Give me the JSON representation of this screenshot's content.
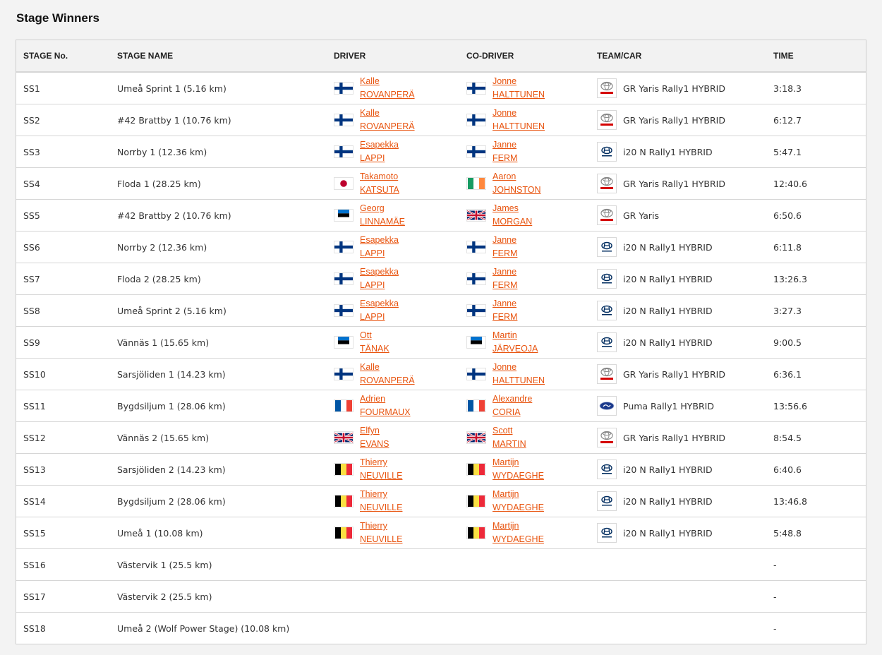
{
  "page_title": "Stage Winners",
  "headers": [
    "STAGE No.",
    "STAGE NAME",
    "DRIVER",
    "CO-DRIVER",
    "TEAM/CAR",
    "TIME"
  ],
  "rows": [
    {
      "stage": "SS1",
      "name": "Umeå Sprint 1 (5.16 km)",
      "driver_first": "Kalle",
      "driver_last": "ROVANPERÄ",
      "driver_flag": "finland-flag-icon",
      "codriver_first": "Jonne",
      "codriver_last": "HALTTUNEN",
      "codriver_flag": "finland-flag-icon",
      "logo": "toyota-logo-icon",
      "car": "GR Yaris Rally1 HYBRID",
      "time": "3:18.3"
    },
    {
      "stage": "SS2",
      "name": "#42 Brattby 1 (10.76 km)",
      "driver_first": "Kalle",
      "driver_last": "ROVANPERÄ",
      "driver_flag": "finland-flag-icon",
      "codriver_first": "Jonne",
      "codriver_last": "HALTTUNEN",
      "codriver_flag": "finland-flag-icon",
      "logo": "toyota-logo-icon",
      "car": "GR Yaris Rally1 HYBRID",
      "time": "6:12.7"
    },
    {
      "stage": "SS3",
      "name": "Norrby 1 (12.36 km)",
      "driver_first": "Esapekka",
      "driver_last": "LAPPI",
      "driver_flag": "finland-flag-icon",
      "codriver_first": "Janne",
      "codriver_last": "FERM",
      "codriver_flag": "finland-flag-icon",
      "logo": "hyundai-logo-icon",
      "car": "i20 N Rally1 HYBRID",
      "time": "5:47.1"
    },
    {
      "stage": "SS4",
      "name": "Floda 1 (28.25 km)",
      "driver_first": "Takamoto",
      "driver_last": "KATSUTA",
      "driver_flag": "japan-flag-icon",
      "codriver_first": "Aaron",
      "codriver_last": "JOHNSTON",
      "codriver_flag": "ireland-flag-icon",
      "logo": "toyota-logo-icon",
      "car": "GR Yaris Rally1 HYBRID",
      "time": "12:40.6"
    },
    {
      "stage": "SS5",
      "name": "#42 Brattby 2 (10.76 km)",
      "driver_first": "Georg",
      "driver_last": "LINNAMÄE",
      "driver_flag": "estonia-flag-icon",
      "codriver_first": "James",
      "codriver_last": "MORGAN",
      "codriver_flag": "uk-flag-icon",
      "logo": "toyota-logo-icon",
      "car": "GR Yaris",
      "time": "6:50.6"
    },
    {
      "stage": "SS6",
      "name": "Norrby 2 (12.36 km)",
      "driver_first": "Esapekka",
      "driver_last": "LAPPI",
      "driver_flag": "finland-flag-icon",
      "codriver_first": "Janne",
      "codriver_last": "FERM",
      "codriver_flag": "finland-flag-icon",
      "logo": "hyundai-logo-icon",
      "car": "i20 N Rally1 HYBRID",
      "time": "6:11.8"
    },
    {
      "stage": "SS7",
      "name": "Floda 2 (28.25 km)",
      "driver_first": "Esapekka",
      "driver_last": "LAPPI",
      "driver_flag": "finland-flag-icon",
      "codriver_first": "Janne",
      "codriver_last": "FERM",
      "codriver_flag": "finland-flag-icon",
      "logo": "hyundai-logo-icon",
      "car": "i20 N Rally1 HYBRID",
      "time": "13:26.3"
    },
    {
      "stage": "SS8",
      "name": "Umeå Sprint 2 (5.16 km)",
      "driver_first": "Esapekka",
      "driver_last": "LAPPI",
      "driver_flag": "finland-flag-icon",
      "codriver_first": "Janne",
      "codriver_last": "FERM",
      "codriver_flag": "finland-flag-icon",
      "logo": "hyundai-logo-icon",
      "car": "i20 N Rally1 HYBRID",
      "time": "3:27.3"
    },
    {
      "stage": "SS9",
      "name": "Vännäs 1 (15.65 km)",
      "driver_first": "Ott",
      "driver_last": "TÄNAK",
      "driver_flag": "estonia-flag-icon",
      "codriver_first": "Martin",
      "codriver_last": "JÄRVEOJA",
      "codriver_flag": "estonia-flag-icon",
      "logo": "hyundai-logo-icon",
      "car": "i20 N Rally1 HYBRID",
      "time": "9:00.5"
    },
    {
      "stage": "SS10",
      "name": "Sarsjöliden 1 (14.23 km)",
      "driver_first": "Kalle",
      "driver_last": "ROVANPERÄ",
      "driver_flag": "finland-flag-icon",
      "codriver_first": "Jonne",
      "codriver_last": "HALTTUNEN",
      "codriver_flag": "finland-flag-icon",
      "logo": "toyota-logo-icon",
      "car": "GR Yaris Rally1 HYBRID",
      "time": "6:36.1"
    },
    {
      "stage": "SS11",
      "name": "Bygdsiljum 1 (28.06 km)",
      "driver_first": "Adrien",
      "driver_last": "FOURMAUX",
      "driver_flag": "france-flag-icon",
      "codriver_first": "Alexandre",
      "codriver_last": "CORIA",
      "codriver_flag": "france-flag-icon",
      "logo": "ford-logo-icon",
      "car": "Puma Rally1 HYBRID",
      "time": "13:56.6"
    },
    {
      "stage": "SS12",
      "name": "Vännäs 2 (15.65 km)",
      "driver_first": "Elfyn",
      "driver_last": "EVANS",
      "driver_flag": "uk-flag-icon",
      "codriver_first": "Scott",
      "codriver_last": "MARTIN",
      "codriver_flag": "uk-flag-icon",
      "logo": "toyota-logo-icon",
      "car": "GR Yaris Rally1 HYBRID",
      "time": "8:54.5"
    },
    {
      "stage": "SS13",
      "name": "Sarsjöliden 2 (14.23 km)",
      "driver_first": "Thierry",
      "driver_last": "NEUVILLE",
      "driver_flag": "belgium-flag-icon",
      "codriver_first": "Martijn",
      "codriver_last": "WYDAEGHE",
      "codriver_flag": "belgium-flag-icon",
      "logo": "hyundai-logo-icon",
      "car": "i20 N Rally1 HYBRID",
      "time": "6:40.6"
    },
    {
      "stage": "SS14",
      "name": "Bygdsiljum 2 (28.06 km)",
      "driver_first": "Thierry",
      "driver_last": "NEUVILLE",
      "driver_flag": "belgium-flag-icon",
      "codriver_first": "Martijn",
      "codriver_last": "WYDAEGHE",
      "codriver_flag": "belgium-flag-icon",
      "logo": "hyundai-logo-icon",
      "car": "i20 N Rally1 HYBRID",
      "time": "13:46.8"
    },
    {
      "stage": "SS15",
      "name": "Umeå 1 (10.08 km)",
      "driver_first": "Thierry",
      "driver_last": "NEUVILLE",
      "driver_flag": "belgium-flag-icon",
      "codriver_first": "Martijn",
      "codriver_last": "WYDAEGHE",
      "codriver_flag": "belgium-flag-icon",
      "logo": "hyundai-logo-icon",
      "car": "i20 N Rally1 HYBRID",
      "time": "5:48.8"
    },
    {
      "stage": "SS16",
      "name": "Västervik 1 (25.5 km)",
      "time": "-"
    },
    {
      "stage": "SS17",
      "name": "Västervik 2 (25.5 km)",
      "time": "-"
    },
    {
      "stage": "SS18",
      "name": "Umeå 2 (Wolf Power Stage) (10.08 km)",
      "time": "-"
    }
  ],
  "colors": {
    "link": "#e8530e",
    "toyota_red": "#d40000",
    "hyundai_blue": "#002c5f",
    "ford_blue": "#1b3a8c"
  }
}
